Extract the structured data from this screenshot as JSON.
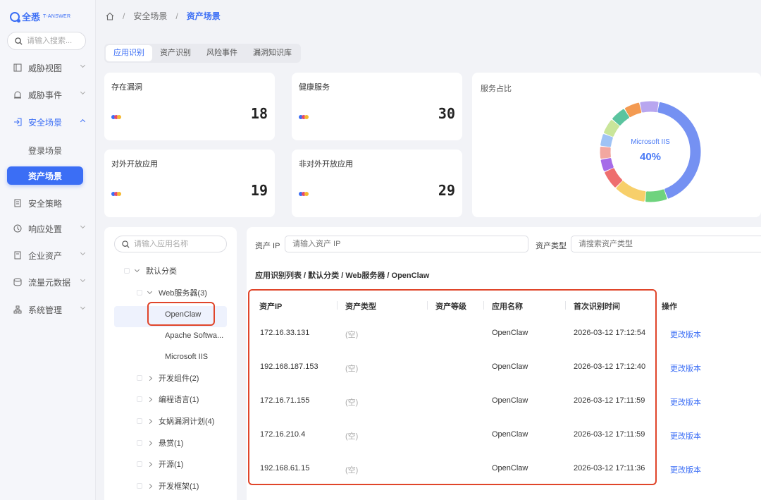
{
  "brand": {
    "name": "全悉",
    "sub": "T-ANSWER"
  },
  "sidebar": {
    "search_placeholder": "请输入搜索...",
    "items": [
      {
        "label": "威胁视图",
        "icon": "dashboard-icon"
      },
      {
        "label": "威胁事件",
        "icon": "alarm-icon"
      },
      {
        "label": "安全场景",
        "icon": "login-icon"
      },
      {
        "label": "安全策略",
        "icon": "policy-icon"
      },
      {
        "label": "响应处置",
        "icon": "response-icon"
      },
      {
        "label": "企业资产",
        "icon": "asset-icon"
      },
      {
        "label": "流量元数据",
        "icon": "database-icon"
      },
      {
        "label": "系统管理",
        "icon": "system-icon"
      }
    ],
    "subitems": [
      {
        "label": "登录场景"
      },
      {
        "label": "资产场景"
      }
    ]
  },
  "breadcrumb": {
    "level1": "安全场景",
    "level2": "资产场景",
    "sep": "/"
  },
  "tabs": [
    "应用识别",
    "资产识别",
    "风险事件",
    "漏洞知识库"
  ],
  "stats": [
    {
      "title": "存在漏洞",
      "value": "18"
    },
    {
      "title": "健康服务",
      "value": "30"
    },
    {
      "title": "对外开放应用",
      "value": "19"
    },
    {
      "title": "非对外开放应用",
      "value": "29"
    }
  ],
  "colors": {
    "accent": "#3b6ef5",
    "dot1": "#3b6ef5",
    "dot2": "#e64a6b",
    "dot3": "#f5b82e",
    "highlight": "#e0452a"
  },
  "chart_data": {
    "type": "pie",
    "title": "服务占比",
    "center_label": "Microsoft IIS",
    "center_value": "40%",
    "series": [
      {
        "name": "Microsoft IIS",
        "value": 40,
        "color": "#7591f2"
      },
      {
        "value": 7,
        "color": "#6fd37e"
      },
      {
        "value": 10,
        "color": "#f7cf6a"
      },
      {
        "value": 6,
        "color": "#ee6e6e"
      },
      {
        "value": 4,
        "color": "#a66ce8"
      },
      {
        "value": 4,
        "color": "#f2a7a0"
      },
      {
        "value": 4,
        "color": "#9fc3f5"
      },
      {
        "value": 5,
        "color": "#c9e59a"
      },
      {
        "value": 5,
        "color": "#5bc49f"
      },
      {
        "value": 5,
        "color": "#f39a52"
      },
      {
        "value": 6,
        "color": "#b8a6ef"
      }
    ]
  },
  "tree": {
    "search_placeholder": "请输入应用名称",
    "root": "默认分类",
    "web_server": "Web服务器(3)",
    "web_children": [
      "OpenClaw",
      "Apache Softwa...",
      "Microsoft IIS"
    ],
    "other_groups": [
      "开发组件(2)",
      "编程语言(1)",
      "女娲漏洞计划(4)",
      "悬赏(1)",
      "开源(1)",
      "开发框架(1)"
    ]
  },
  "filters": {
    "ip_label": "资产 IP",
    "ip_placeholder": "请输入资产 IP",
    "type_label": "资产类型",
    "type_placeholder": "请搜索资产类型"
  },
  "path": "应用识别列表 / 默认分类 / Web服务器 / OpenClaw",
  "table": {
    "columns": [
      "资产IP",
      "资产类型",
      "资产等级",
      "应用名称",
      "首次识别时间",
      "操作"
    ],
    "rows": [
      {
        "ip": "172.16.33.131",
        "type": "(空)",
        "app": "OpenClaw",
        "time": "2026-03-12 17:12:54",
        "action": "更改版本"
      },
      {
        "ip": "192.168.187.153",
        "type": "(空)",
        "app": "OpenClaw",
        "time": "2026-03-12 17:12:40",
        "action": "更改版本"
      },
      {
        "ip": "172.16.71.155",
        "type": "(空)",
        "app": "OpenClaw",
        "time": "2026-03-12 17:11:59",
        "action": "更改版本"
      },
      {
        "ip": "172.16.210.4",
        "type": "(空)",
        "app": "OpenClaw",
        "time": "2026-03-12 17:11:59",
        "action": "更改版本"
      },
      {
        "ip": "192.168.61.15",
        "type": "(空)",
        "app": "OpenClaw",
        "time": "2026-03-12 17:11:36",
        "action": "更改版本"
      }
    ]
  }
}
